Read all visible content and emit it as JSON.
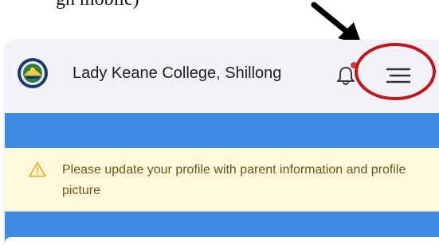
{
  "caption": {
    "text": "gh mobile)"
  },
  "header": {
    "college_name": "Lady Keane College, Shillong",
    "logo_icon": "college-emblem",
    "notification_icon": "bell-icon",
    "menu_icon": "hamburger-menu-icon",
    "notification_dot_color": "#d63a3a"
  },
  "alert": {
    "icon": "warning-triangle-icon",
    "message": "Please update your profile with parent information and profile picture"
  },
  "colors": {
    "header_bg": "#f1f3f9",
    "blue_band": "#3f8ae4",
    "alert_bg": "#fff8dd",
    "alert_text": "#6a5517",
    "annotation_red": "#c1161c"
  }
}
